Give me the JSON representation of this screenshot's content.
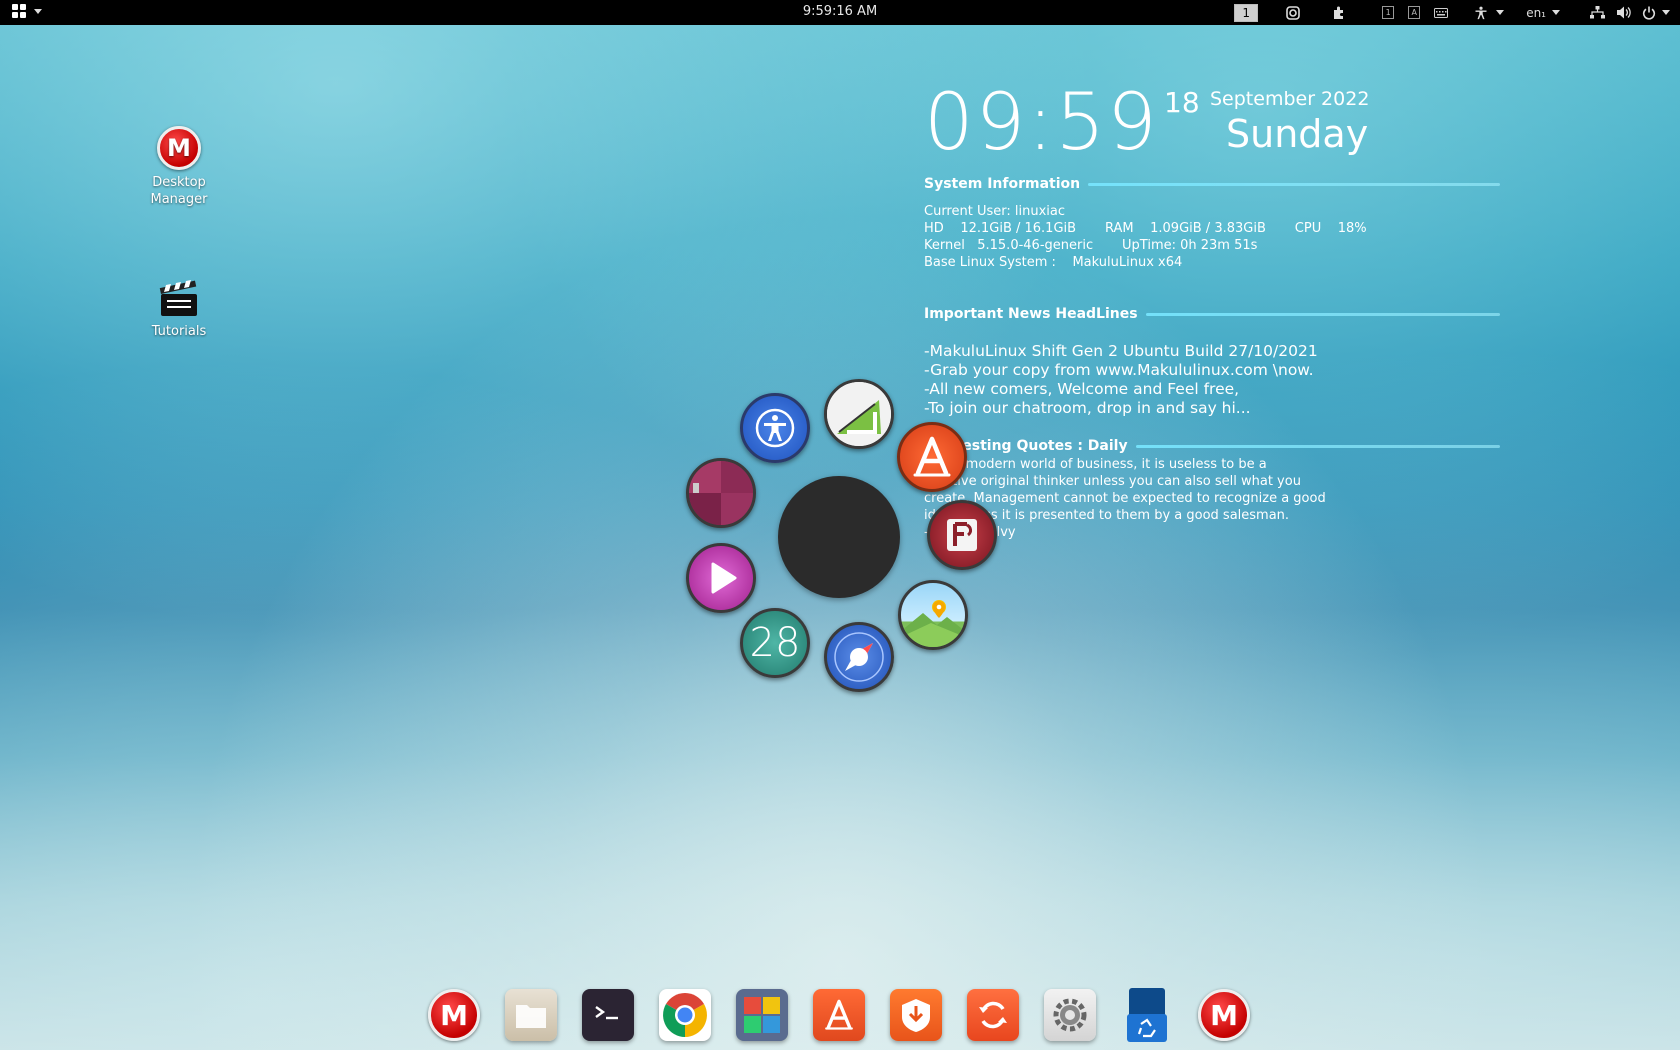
{
  "topbar": {
    "clock": "9:59:16 AM",
    "workspace": "1",
    "keyboard_layout": "en₁",
    "mini_indicators": [
      "1",
      "A"
    ],
    "icons": [
      "apps-grid-icon",
      "screenshot-icon",
      "extension-icon",
      "keyboard-icon",
      "accessibility-icon",
      "network-icon",
      "volume-icon",
      "power-icon"
    ]
  },
  "desktop_icons": [
    {
      "label_line1": "Desktop",
      "label_line2": "Manager",
      "icon": "makulu-logo-icon"
    },
    {
      "label_line1": "Tutorials",
      "label_line2": "",
      "icon": "clapperboard-icon"
    }
  ],
  "conky": {
    "time": "09:59",
    "day": "18",
    "month_year": "September 2022",
    "weekday": "Sunday",
    "system_title": "System Information",
    "system_lines": [
      "Current User: linuxiac",
      "HD    12.1GiB / 16.1GiB       RAM    1.09GiB / 3.83GiB       CPU    18%",
      "Kernel   5.15.0-46-generic       UpTime: 0h 23m 51s",
      "Base Linux System :    MakuluLinux x64"
    ],
    "news_title": "Important News HeadLines",
    "news_lines": [
      "-MakuluLinux Shift Gen 2 Ubuntu Build 27/10/2021",
      "-Grab your copy from www.Makululinux.com \\now.",
      "-All new comers, Welcome and Feel free,",
      "-To join our chatroom, drop in and say hi..."
    ],
    "quotes_title": "Interesting Quotes : Daily",
    "quote_lines": [
      "In the modern world of business, it is useless to be a",
      "creative original thinker unless you can also sell what you",
      "create. Management cannot be expected to recognize a good",
      "idea unless it is presented to them by a good salesman.",
      "- David Ogilvy"
    ]
  },
  "launcher": {
    "calendar_day": "28",
    "apps": [
      "accessibility-icon",
      "drawing-icon",
      "app-store-icon",
      "fontforge-icon",
      "image-viewer-icon",
      "web-browser-icon",
      "calendar-icon",
      "media-player-icon",
      "theme-icon"
    ]
  },
  "dock": {
    "items": [
      "makulu-logo-icon",
      "files-icon",
      "terminal-icon",
      "chrome-icon",
      "app-grid-icon",
      "app-store-icon",
      "installer-icon",
      "updater-icon",
      "settings-icon",
      "recycle-bin-icon",
      "makulu-logo-icon"
    ]
  },
  "colors": {
    "accent": "#e0481e",
    "conky_line": "#78e6ff",
    "makulu_red": "#c40000"
  }
}
